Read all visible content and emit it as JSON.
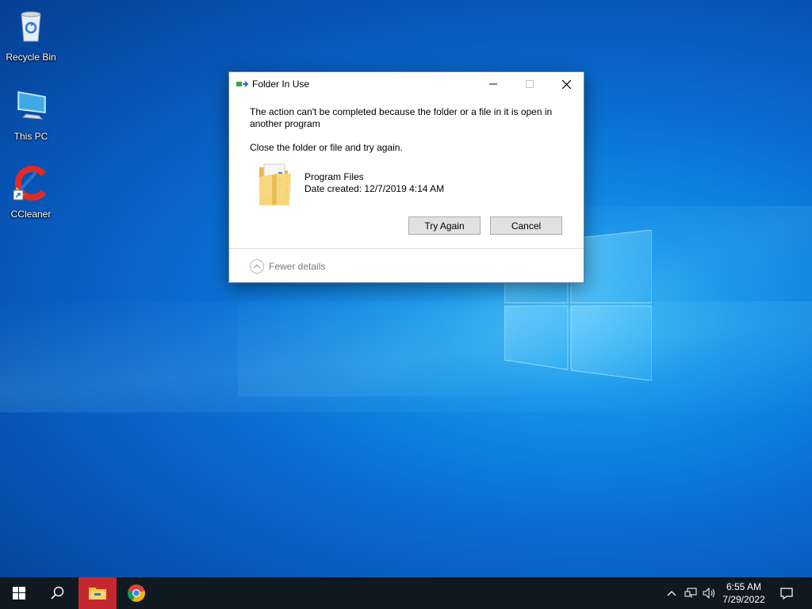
{
  "desktop": {
    "icons": [
      {
        "label": "Recycle Bin",
        "icon": "recycle-bin-icon"
      },
      {
        "label": "This PC",
        "icon": "computer-icon"
      },
      {
        "label": "CCleaner",
        "icon": "ccleaner-icon"
      }
    ]
  },
  "dialog": {
    "title": "Folder In Use",
    "message": "The action can't be completed because the folder or a file in it is open in another program",
    "instruction": "Close the folder or file and try again.",
    "file_name": "Program Files",
    "file_date": "Date created: 12/7/2019 4:14 AM",
    "try_again_label": "Try Again",
    "cancel_label": "Cancel",
    "details_label": "Fewer details"
  },
  "taskbar": {
    "time": "6:55 AM",
    "date": "7/29/2022",
    "apps": [
      "start-icon",
      "search-icon",
      "file-explorer-icon",
      "chrome-icon"
    ],
    "tray": [
      "chevron-up-icon",
      "network-icon",
      "volume-icon",
      "notification-icon"
    ]
  },
  "colors": {
    "desktop_blue": "#0a6fd2",
    "taskbar": "#101820",
    "active_app": "#c4282e"
  }
}
